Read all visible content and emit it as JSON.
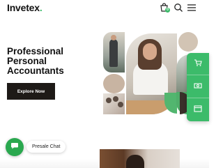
{
  "header": {
    "logo_text": "Invetex",
    "cart_count": "0",
    "icons": [
      "cart-icon",
      "search-icon",
      "menu-icon"
    ]
  },
  "hero": {
    "title_lines": [
      "Professional",
      "Personal",
      "Accountants"
    ],
    "cta_label": "Explore Now"
  },
  "side_bar": {
    "icons": [
      "cart-icon",
      "money-icon",
      "browser-window-icon"
    ],
    "accent_color": "#3cbb6a"
  },
  "chat": {
    "label": "Presale Chat",
    "icon": "chat-bubble-icon",
    "color": "#2aa84f"
  }
}
